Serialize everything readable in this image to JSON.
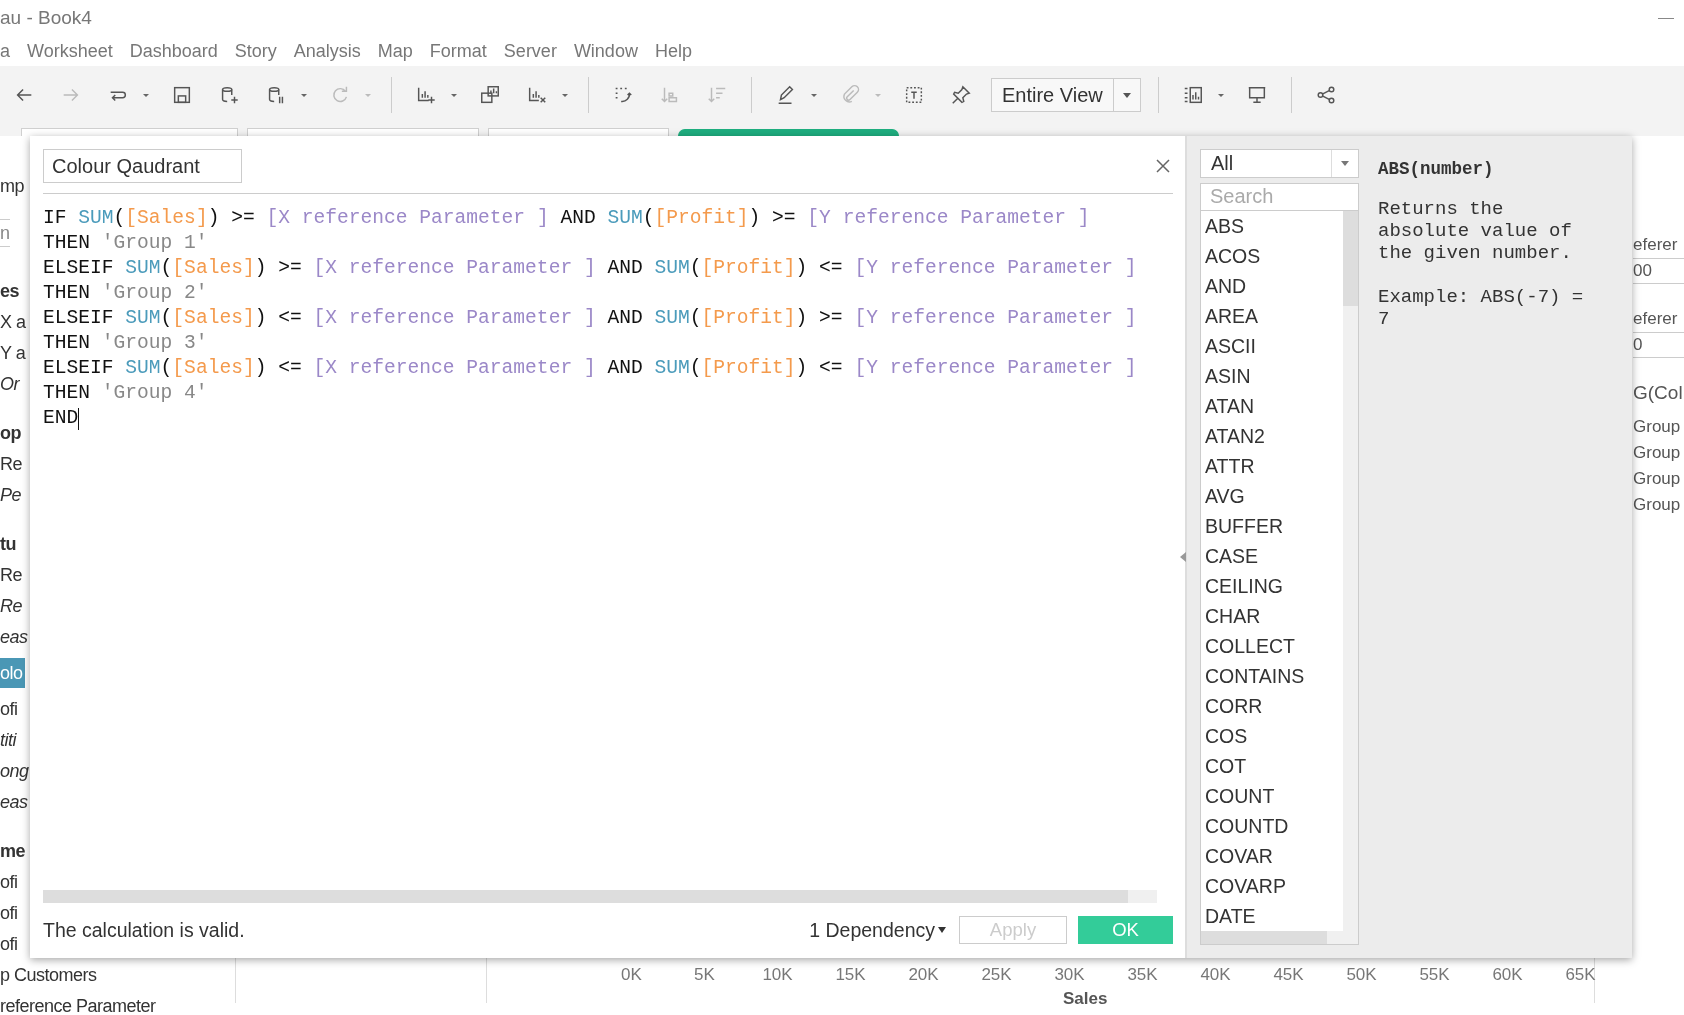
{
  "window": {
    "title": "au - Book4"
  },
  "menu": [
    "a",
    "Worksheet",
    "Dashboard",
    "Story",
    "Analysis",
    "Map",
    "Format",
    "Server",
    "Window",
    "Help"
  ],
  "toolbar": [
    {
      "kind": "button",
      "disabled": false,
      "menu": false
    },
    {
      "kind": "button",
      "disabled": true,
      "menu": false
    },
    {
      "kind": "button",
      "disabled": false,
      "menu": true
    },
    {
      "kind": "button",
      "disabled": false,
      "menu": false
    },
    {
      "kind": "button",
      "disabled": false,
      "menu": false
    },
    {
      "kind": "button",
      "disabled": false,
      "menu": true
    },
    {
      "kind": "button",
      "disabled": true,
      "menu": true
    },
    {
      "kind": "separator"
    },
    {
      "kind": "button",
      "disabled": false,
      "menu": true
    },
    {
      "kind": "button",
      "disabled": false,
      "menu": false
    },
    {
      "kind": "button",
      "disabled": false,
      "menu": true
    },
    {
      "kind": "separator"
    },
    {
      "kind": "button",
      "disabled": false,
      "menu": false
    },
    {
      "kind": "button",
      "disabled": true,
      "menu": false
    },
    {
      "kind": "button",
      "disabled": true,
      "menu": false
    },
    {
      "kind": "separator"
    },
    {
      "kind": "button",
      "disabled": false,
      "menu": true
    },
    {
      "kind": "button",
      "disabled": true,
      "menu": true
    },
    {
      "kind": "button",
      "disabled": false,
      "menu": false
    },
    {
      "kind": "button",
      "disabled": false,
      "menu": false
    },
    {
      "kind": "dropdown",
      "label": "Entire View"
    },
    {
      "kind": "separator"
    },
    {
      "kind": "button",
      "disabled": false,
      "menu": true
    },
    {
      "kind": "button",
      "disabled": false,
      "menu": false
    },
    {
      "kind": "separator"
    },
    {
      "kind": "button",
      "disabled": false,
      "menu": false
    }
  ],
  "tabs": [
    {
      "selected": false
    },
    {
      "selected": false
    },
    {
      "selected": false
    },
    {
      "selected": true
    }
  ],
  "sidebar": {
    "items": [
      {
        "kind": "plain",
        "text": "mp"
      },
      {
        "kind": "search",
        "text": "n"
      },
      {
        "kind": "heading",
        "text": "es"
      },
      {
        "kind": "plain",
        "text": "X a"
      },
      {
        "kind": "plain",
        "text": "Y a"
      },
      {
        "kind": "italic",
        "text": "Or"
      },
      {
        "kind": "heading",
        "text": "op"
      },
      {
        "kind": "plain",
        "text": "Re"
      },
      {
        "kind": "italic",
        "text": "Pe"
      },
      {
        "kind": "heading",
        "text": "tu"
      },
      {
        "kind": "plain",
        "text": "Re"
      },
      {
        "kind": "italic",
        "text": "Re"
      },
      {
        "kind": "italic",
        "text": "eas",
        "selected": false
      },
      {
        "kind": "plain",
        "text": "olo",
        "selected": true
      },
      {
        "kind": "plain",
        "text": "ofi"
      },
      {
        "kind": "italic",
        "text": "titi"
      },
      {
        "kind": "italic",
        "text": "ong"
      },
      {
        "kind": "italic",
        "text": "eas"
      },
      {
        "kind": "heading",
        "text": "me"
      },
      {
        "kind": "plain",
        "text": "ofi"
      },
      {
        "kind": "plain",
        "text": "ofi"
      },
      {
        "kind": "plain",
        "text": "ofi"
      },
      {
        "kind": "plain",
        "text": "p Customers"
      },
      {
        "kind": "plain",
        "text": "reference Parameter"
      }
    ]
  },
  "right_panel": [
    {
      "kind": "label",
      "text": "eferer"
    },
    {
      "kind": "field",
      "text": "00"
    },
    {
      "kind": "label",
      "text": "eferer"
    },
    {
      "kind": "field",
      "text": "0"
    },
    {
      "kind": "header",
      "text": "G(Col"
    },
    {
      "kind": "label",
      "text": "Group"
    },
    {
      "kind": "label",
      "text": "Group"
    },
    {
      "kind": "label",
      "text": "Group"
    },
    {
      "kind": "label",
      "text": "Group"
    }
  ],
  "axis": {
    "ticks": [
      "0K",
      "5K",
      "10K",
      "15K",
      "20K",
      "25K",
      "30K",
      "35K",
      "40K",
      "45K",
      "50K",
      "55K",
      "60K",
      "65K"
    ],
    "title": "Sales"
  },
  "dialog": {
    "name": "Colour Qaudrant",
    "code": [
      [
        {
          "kind": "plain",
          "text": "IF "
        },
        {
          "kind": "function",
          "text": "SUM"
        },
        {
          "kind": "plain",
          "text": "("
        },
        {
          "kind": "field",
          "text": "[Sales]"
        },
        {
          "kind": "plain",
          "text": ") >= "
        },
        {
          "kind": "parameter",
          "text": "[X reference Parameter ]"
        },
        {
          "kind": "plain",
          "text": " AND "
        },
        {
          "kind": "function",
          "text": "SUM"
        },
        {
          "kind": "plain",
          "text": "("
        },
        {
          "kind": "field",
          "text": "[Profit]"
        },
        {
          "kind": "plain",
          "text": ") >= "
        },
        {
          "kind": "parameter",
          "text": "[Y reference Parameter ]"
        }
      ],
      [
        {
          "kind": "plain",
          "text": "THEN "
        },
        {
          "kind": "string",
          "text": "'Group 1'"
        }
      ],
      [
        {
          "kind": "plain",
          "text": "ELSEIF "
        },
        {
          "kind": "function",
          "text": "SUM"
        },
        {
          "kind": "plain",
          "text": "("
        },
        {
          "kind": "field",
          "text": "[Sales]"
        },
        {
          "kind": "plain",
          "text": ") >= "
        },
        {
          "kind": "parameter",
          "text": "[X reference Parameter ]"
        },
        {
          "kind": "plain",
          "text": " AND "
        },
        {
          "kind": "function",
          "text": "SUM"
        },
        {
          "kind": "plain",
          "text": "("
        },
        {
          "kind": "field",
          "text": "[Profit]"
        },
        {
          "kind": "plain",
          "text": ") <= "
        },
        {
          "kind": "parameter",
          "text": "[Y reference Parameter ]"
        }
      ],
      [
        {
          "kind": "plain",
          "text": "THEN "
        },
        {
          "kind": "string",
          "text": "'Group 2'"
        }
      ],
      [
        {
          "kind": "plain",
          "text": "ELSEIF "
        },
        {
          "kind": "function",
          "text": "SUM"
        },
        {
          "kind": "plain",
          "text": "("
        },
        {
          "kind": "field",
          "text": "[Sales]"
        },
        {
          "kind": "plain",
          "text": ") <= "
        },
        {
          "kind": "parameter",
          "text": "[X reference Parameter ]"
        },
        {
          "kind": "plain",
          "text": " AND "
        },
        {
          "kind": "function",
          "text": "SUM"
        },
        {
          "kind": "plain",
          "text": "("
        },
        {
          "kind": "field",
          "text": "[Profit]"
        },
        {
          "kind": "plain",
          "text": ") >= "
        },
        {
          "kind": "parameter",
          "text": "[Y reference Parameter ]"
        }
      ],
      [
        {
          "kind": "plain",
          "text": "THEN "
        },
        {
          "kind": "string",
          "text": "'Group 3'"
        }
      ],
      [
        {
          "kind": "plain",
          "text": "ELSEIF "
        },
        {
          "kind": "function",
          "text": "SUM"
        },
        {
          "kind": "plain",
          "text": "("
        },
        {
          "kind": "field",
          "text": "[Sales]"
        },
        {
          "kind": "plain",
          "text": ") <= "
        },
        {
          "kind": "parameter",
          "text": "[X reference Parameter ]"
        },
        {
          "kind": "plain",
          "text": " AND "
        },
        {
          "kind": "function",
          "text": "SUM"
        },
        {
          "kind": "plain",
          "text": "("
        },
        {
          "kind": "field",
          "text": "[Profit]"
        },
        {
          "kind": "plain",
          "text": ") <= "
        },
        {
          "kind": "parameter",
          "text": "[Y reference Parameter ]"
        }
      ],
      [
        {
          "kind": "plain",
          "text": "THEN "
        },
        {
          "kind": "string",
          "text": "'Group 4'"
        }
      ],
      [
        {
          "kind": "plain",
          "text": "END"
        }
      ]
    ],
    "cursor_at_end": true,
    "status": "The calculation is valid.",
    "dependency": "1 Dependency",
    "buttons": [
      {
        "kind": "apply",
        "label": "Apply",
        "disabled": true
      },
      {
        "kind": "ok",
        "label": "OK",
        "disabled": false
      }
    ],
    "category": "All",
    "search": {
      "placeholder": "Search"
    },
    "functions": [
      "ABS",
      "ACOS",
      "AND",
      "AREA",
      "ASCII",
      "ASIN",
      "ATAN",
      "ATAN2",
      "ATTR",
      "AVG",
      "BUFFER",
      "CASE",
      "CEILING",
      "CHAR",
      "COLLECT",
      "CONTAINS",
      "CORR",
      "COS",
      "COT",
      "COUNT",
      "COUNTD",
      "COVAR",
      "COVARP",
      "DATE"
    ],
    "help": {
      "signature": "ABS(number)",
      "description": "Returns the absolute value of the given number.",
      "example": "Example: ABS(-7) = 7"
    }
  }
}
